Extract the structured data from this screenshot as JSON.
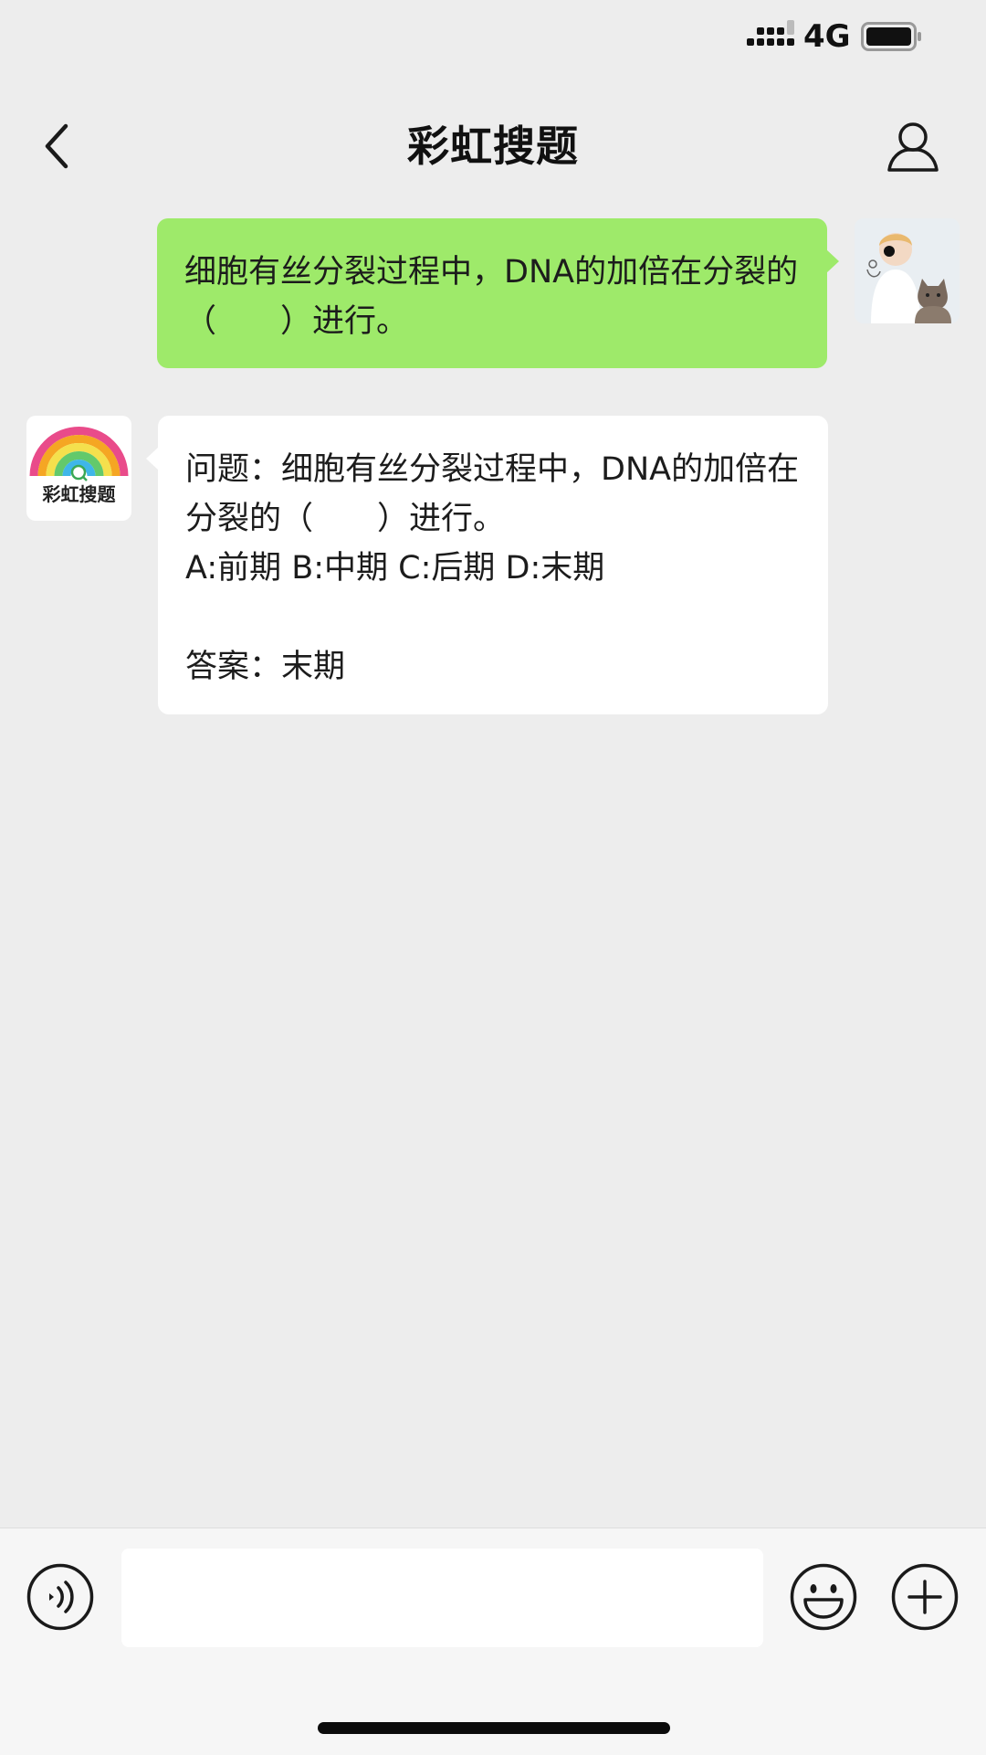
{
  "status_bar": {
    "network": "4G",
    "icons": [
      "signal-icon",
      "battery-icon"
    ]
  },
  "header": {
    "title": "彩虹搜题",
    "back_icon": "chevron-left-icon",
    "profile_icon": "person-icon"
  },
  "messages": [
    {
      "sender": "user",
      "text": "细胞有丝分裂过程中，DNA的加倍在分裂的（　　）进行。"
    },
    {
      "sender": "bot",
      "avatar_label": "彩虹搜题",
      "lines": [
        "问题：细胞有丝分裂过程中，DNA的加倍在分裂的（　　）进行。",
        "A:前期 B:中期 C:后期 D:末期",
        "",
        "答案：末期"
      ]
    }
  ],
  "input_bar": {
    "value": "",
    "icons": [
      "voice-icon",
      "emoji-icon",
      "plus-icon"
    ]
  },
  "colors": {
    "background": "#ededed",
    "user_bubble": "#9eea6a",
    "bot_bubble": "#ffffff",
    "input_bar": "#f6f6f6"
  }
}
